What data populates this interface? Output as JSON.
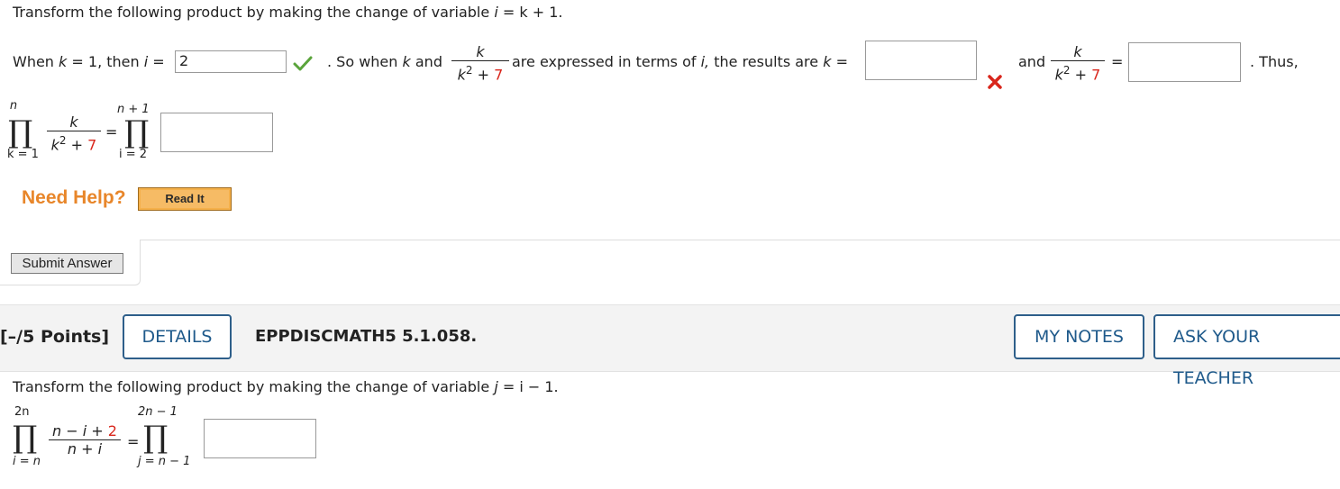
{
  "q1": {
    "intro": "Transform the following product by making the change of variable",
    "intro_var_i": "i",
    "intro_rest": "= k + 1.",
    "when_label": "When",
    "when_k": "k",
    "when_mid": "= 1, then",
    "when_i": "i",
    "when_eq": "=",
    "i_value": "2",
    "so_when": ". So when",
    "so_k": "k",
    "so_and": "and",
    "frac_num": "k",
    "frac_den_base": "k",
    "frac_den_sup": "2",
    "frac_den_plus": "+",
    "frac_den_const": "7",
    "expressed_text": "are expressed in terms of",
    "expressed_i": "i,",
    "results_text": "the results are",
    "results_k": "k",
    "results_eq": "=",
    "k_answer": "",
    "and_label": "and",
    "eq_sign": "=",
    "frac_answer": "",
    "thus": ". Thus,",
    "prod_upper": "n",
    "prod_lower": "k = 1",
    "rhs_upper": "n + 1",
    "rhs_lower": "i = 2",
    "prod_answer": "",
    "need_help": "Need Help?",
    "read_it": "Read It",
    "submit": "Submit Answer"
  },
  "q2": {
    "points": "[–/5 Points]",
    "details": "DETAILS",
    "code": "EPPDISCMATH5 5.1.058.",
    "my_notes": "MY NOTES",
    "ask_teacher": "ASK YOUR TEACHER",
    "intro": "Transform the following product by making the change of variable",
    "intro_var": "j",
    "intro_rest": "= i − 1.",
    "prod_upper": "2n",
    "prod_lower": "i = n",
    "frac_num_main": "n − i +",
    "frac_num_const": "2",
    "frac_den": "n + i",
    "eq": "=",
    "rhs_upper": "2n − 1",
    "rhs_lower": "j = n − 1",
    "answer": ""
  },
  "colors": {
    "check": "#5aa43b",
    "cross": "#d9261c",
    "need_help": "#e8862a",
    "read_it_bg": "#f5b04a",
    "accent_blue": "#1f5a8b",
    "red_const": "#d9261c"
  },
  "icons": {
    "check": "check-icon",
    "cross": "cross-icon"
  },
  "symbols": {
    "product": "∏"
  }
}
